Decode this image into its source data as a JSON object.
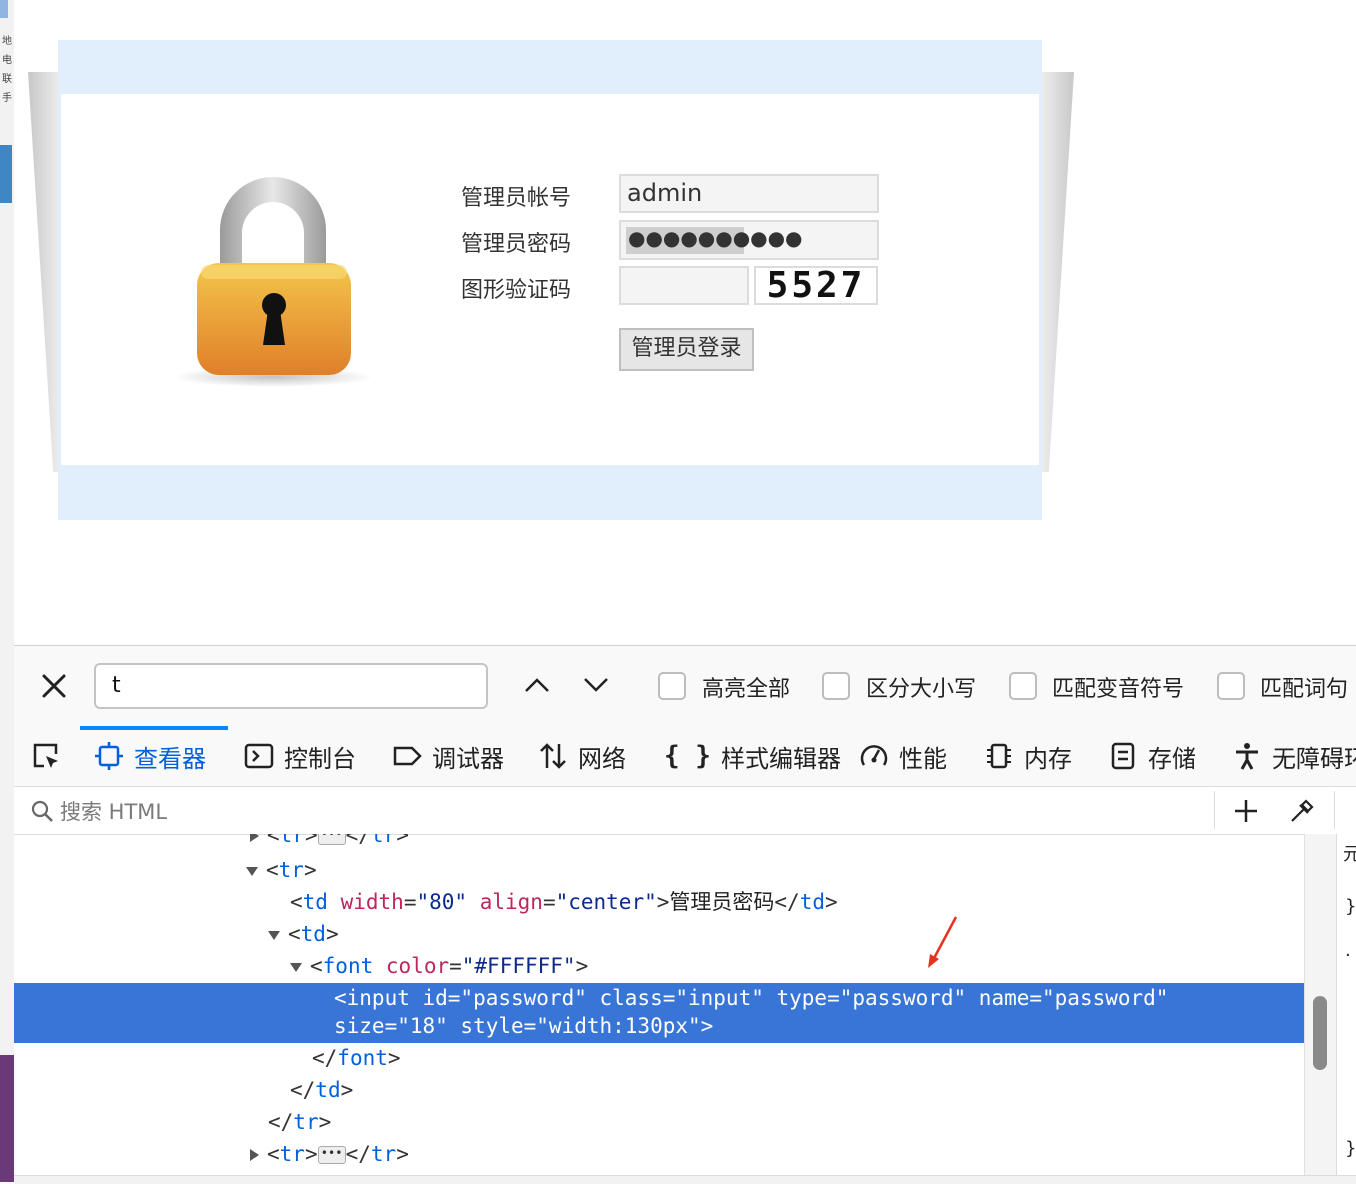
{
  "left_strip": {
    "chars": [
      "地",
      "电",
      "联",
      "手"
    ]
  },
  "login": {
    "username_label": "管理员帐号",
    "username_value": "admin",
    "password_label": "管理员密码",
    "password_mask": "●●●●●●●●●●",
    "captcha_label": "图形验证码",
    "captcha_value": "",
    "captcha_image_text": "5527",
    "login_button": "管理员登录"
  },
  "findbar": {
    "query": "t",
    "options": [
      "高亮全部",
      "区分大小写",
      "匹配变音符号",
      "匹配词句"
    ]
  },
  "tabs": [
    {
      "label": "查看器",
      "icon": "inspector-icon",
      "active": true
    },
    {
      "label": "控制台",
      "icon": "console-icon",
      "active": false
    },
    {
      "label": "调试器",
      "icon": "debugger-icon",
      "active": false
    },
    {
      "label": "网络",
      "icon": "network-icon",
      "active": false
    },
    {
      "label": "样式编辑器",
      "icon": "style-editor-icon",
      "active": false
    },
    {
      "label": "性能",
      "icon": "performance-icon",
      "active": false
    },
    {
      "label": "内存",
      "icon": "memory-icon",
      "active": false
    },
    {
      "label": "存储",
      "icon": "storage-icon",
      "active": false
    },
    {
      "label": "无障碍环",
      "icon": "accessibility-icon",
      "active": false
    }
  ],
  "search": {
    "placeholder": "搜索 HTML"
  },
  "html_tree": {
    "l_tr_open": "tr",
    "l_tr2": "tr",
    "l_td_tag": "td",
    "l_td_attr1": "width",
    "l_td_val1": "\"80\"",
    "l_td_attr2": "align",
    "l_td_val2": "\"center\"",
    "l_td_text": "管理员密码",
    "l_font_tag": "font",
    "l_font_attr": "color",
    "l_font_val": "\"#FFFFFF\"",
    "sel_line1": "<input id=\"password\" class=\"input\" type=\"password\" name=\"password\"",
    "sel_line2": "size=\"18\" style=\"width:130px\">"
  },
  "right_panel": {
    "chars": [
      "元",
      "}",
      ".",
      "}"
    ]
  },
  "colors": {
    "selection": "#3875d7",
    "accent": "#0a84ff",
    "tag": "#0060df",
    "attr": "#c2255c"
  }
}
